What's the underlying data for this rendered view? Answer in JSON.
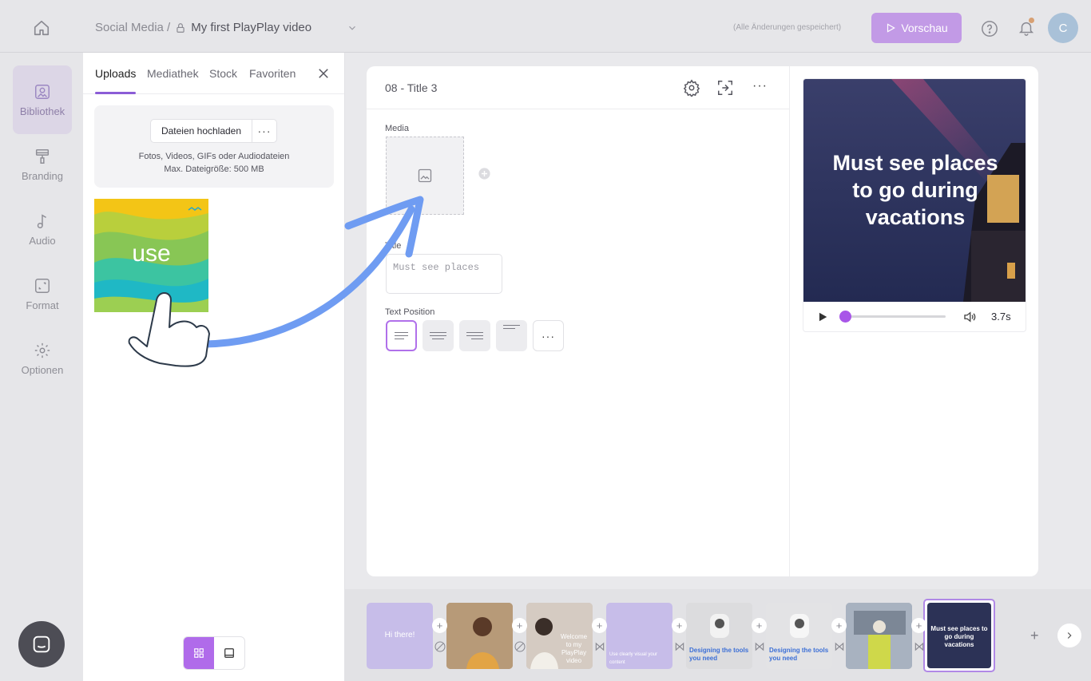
{
  "header": {
    "breadcrumb_root": "Social Media /",
    "project_title": "My first PlayPlay video",
    "saved_status": "(Alle Änderungen gespeichert)",
    "preview_label": "Vorschau",
    "avatar_initial": "C"
  },
  "rail": {
    "items": [
      {
        "label": "Bibliothek",
        "icon": "library-icon",
        "active": true
      },
      {
        "label": "Branding",
        "icon": "paint-roller-icon"
      },
      {
        "label": "Audio",
        "icon": "music-note-icon"
      },
      {
        "label": "Format",
        "icon": "resize-icon"
      },
      {
        "label": "Optionen",
        "icon": "gear-icon"
      }
    ]
  },
  "library": {
    "tabs": [
      "Uploads",
      "Mediathek",
      "Stock",
      "Favoriten"
    ],
    "upload_button": "Dateien hochladen",
    "hint_line1": "Fotos, Videos, GIFs oder Audiodateien",
    "hint_line2": "Max. Dateigröße: 500 MB",
    "thumbnail_text": "use"
  },
  "editor": {
    "scene_title": "08 - Title 3",
    "media_label": "Media",
    "title_label": "Title",
    "title_value": "Must see places",
    "text_position_label": "Text Position"
  },
  "preview": {
    "text": "Must see places to go during vacations",
    "duration": "3.7s",
    "progress": 0.02
  },
  "timeline": {
    "scenes": [
      {
        "text": "Hi there!"
      },
      {
        "text": ""
      },
      {
        "text": "Welcome to my PlayPlay video"
      },
      {
        "text": "Use clearly visual your content"
      },
      {
        "text": "Designing the tools you need"
      },
      {
        "text": "Designing the tools you need"
      },
      {
        "text": ""
      },
      {
        "text": "Must see places to go during vacations"
      }
    ]
  },
  "colors": {
    "accent": "#a855e8",
    "tutorial_arrow": "#6f9cf2"
  }
}
